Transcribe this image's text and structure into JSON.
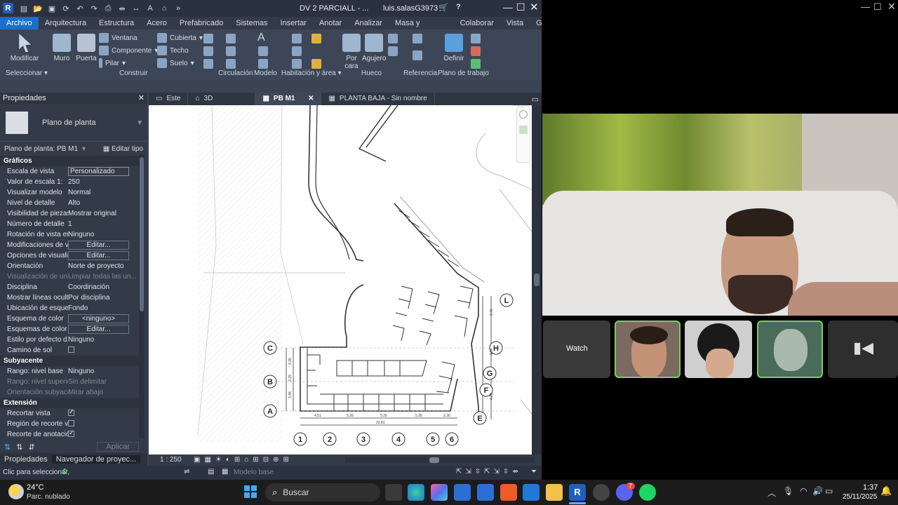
{
  "app": {
    "logo": "R",
    "title": "DV 2 PARCIALL - ...",
    "user": "luis.salasG3973"
  },
  "ribbon_tabs": [
    "Archivo",
    "Arquitectura",
    "Estructura",
    "Acero",
    "Prefabricado",
    "Sistemas",
    "Insertar",
    "Anotar",
    "Analizar",
    "Masa y emplazamiento",
    "Colaborar",
    "Vista",
    "Gestionar"
  ],
  "ribbon": {
    "modificar": "Modificar",
    "muro": "Muro",
    "puerta": "Puerta",
    "ventana": "Ventana",
    "componente": "Componente",
    "pilar": "Pilar",
    "cubierta": "Cubierta",
    "techo": "Techo",
    "suelo": "Suelo",
    "porcara": "Por cara",
    "agujero": "Agujero",
    "definir": "Definir",
    "groups": {
      "seleccionar": "Seleccionar",
      "construir": "Construir",
      "circulacion": "Circulación",
      "modelo": "Modelo",
      "habitacion": "Habitación y área",
      "hueco": "Hueco",
      "referencia": "Referencia",
      "plano": "Plano de trabajo"
    }
  },
  "properties": {
    "title": "Propiedades",
    "type": "Plano de planta",
    "instance": "Plano de planta: PB M1",
    "edit_type": "Editar tipo",
    "sections": {
      "graficos": "Gráficos",
      "subyacente": "Subyacente",
      "extension": "Extensión"
    },
    "graficos": [
      {
        "k": "Escala de vista",
        "v": "Personalizado"
      },
      {
        "k": "Valor de escala    1:",
        "v": "250"
      },
      {
        "k": "Visualizar modelo",
        "v": "Normal"
      },
      {
        "k": "Nivel de detalle",
        "v": "Alto"
      },
      {
        "k": "Visibilidad de piezas",
        "v": "Mostrar original"
      },
      {
        "k": "Número de detalle",
        "v": "1"
      },
      {
        "k": "Rotación de vista en...",
        "v": "Ninguno"
      },
      {
        "k": "Modificaciones de vi...",
        "v": "Editar..."
      },
      {
        "k": "Opciones de visualiz...",
        "v": "Editar..."
      },
      {
        "k": "Orientación",
        "v": "Norte de proyecto"
      },
      {
        "k": "Visualización de uni...",
        "v": "Limpiar todas las un..."
      },
      {
        "k": "Disciplina",
        "v": "Coordinación"
      },
      {
        "k": "Mostrar líneas ocultas",
        "v": "Por disciplina"
      },
      {
        "k": "Ubicación de esque...",
        "v": "Fondo"
      },
      {
        "k": "Esquema de color",
        "v": "<ninguno>"
      },
      {
        "k": "Esquemas de color ...",
        "v": "Editar..."
      },
      {
        "k": "Estilo por defecto d...",
        "v": "Ninguno"
      },
      {
        "k": "Camino de sol",
        "v": ""
      }
    ],
    "subyacente": [
      {
        "k": "Rango: nivel base",
        "v": "Ninguno"
      },
      {
        "k": "Rango: nivel superior",
        "v": "Sin delimitar"
      },
      {
        "k": "Orientación subyace...",
        "v": "Mirar abajo"
      }
    ],
    "extension": [
      {
        "k": "Recortar vista",
        "v": ""
      },
      {
        "k": "Región de recorte vi...",
        "v": ""
      },
      {
        "k": "Recorte de anotación",
        "v": ""
      }
    ],
    "apply": "Aplicar"
  },
  "browser_tabs": [
    "Propiedades",
    "Navegador de proyec..."
  ],
  "view_tabs": [
    "Este",
    "3D",
    "PB M1",
    "PLANTA BAJA - Sin nombre"
  ],
  "plan": {
    "grid_numbers": [
      "1",
      "2",
      "3",
      "4",
      "5",
      "6"
    ],
    "grid_letters": [
      "A",
      "B",
      "C",
      "E",
      "F",
      "G",
      "H",
      "L"
    ],
    "dims": [
      "4.51",
      "5.26",
      "5.26",
      "5.26",
      "2.26",
      "22.81",
      "3.35",
      "3.29",
      "3.46",
      "2.76",
      "4.36",
      "4.22"
    ]
  },
  "viewbar": {
    "scale": "1 : 250"
  },
  "status": {
    "left": "Clic para seleccionar,",
    "model": "Modelo base"
  },
  "meet": {
    "watch": "Watch"
  },
  "taskbar": {
    "temp": "24°C",
    "weather": "Parc. nublado",
    "search": "Buscar",
    "time": "1:37",
    "date": "25/11/2025",
    "discord_badge": "7"
  }
}
